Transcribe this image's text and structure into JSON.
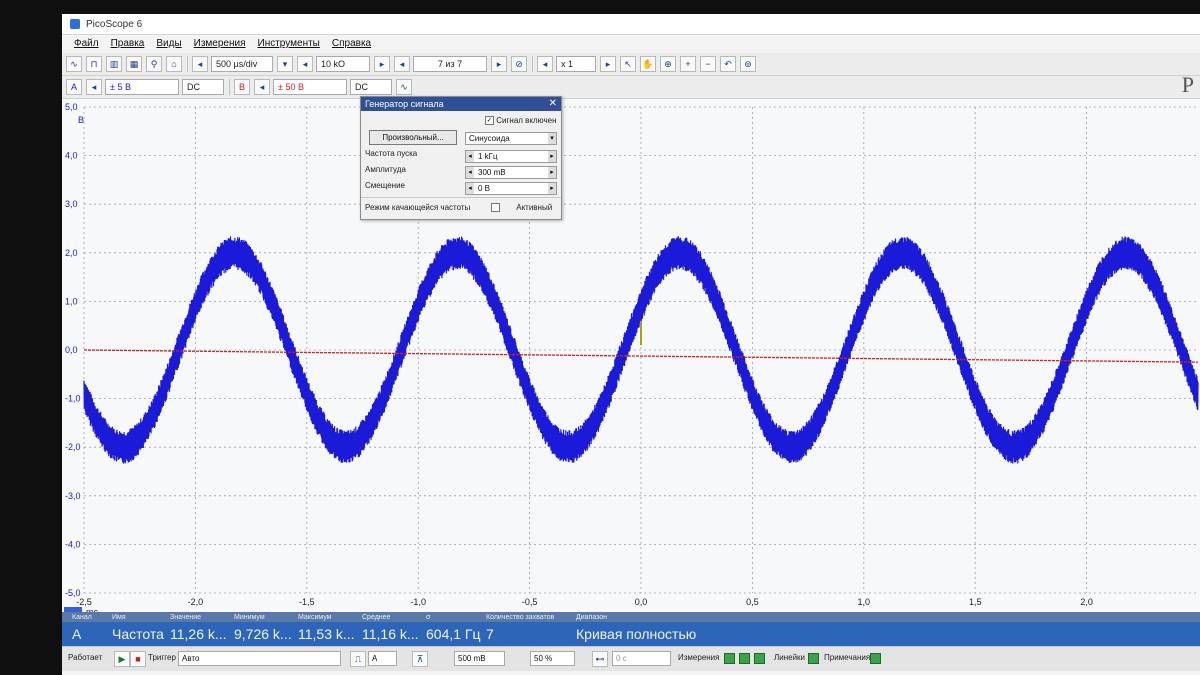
{
  "window": {
    "title": "PicoScope 6"
  },
  "menu": [
    "Файл",
    "Правка",
    "Виды",
    "Измерения",
    "Инструменты",
    "Справка"
  ],
  "toolbar1": {
    "timebase": "500 µs/div",
    "samples": "10 kO",
    "capture": "7 из 7",
    "zoom": "x 1"
  },
  "toolbar2": {
    "channel_a_label": "A",
    "channel_a_range": "± 5 В",
    "channel_a_coupling": "DC",
    "channel_b_label": "B",
    "channel_b_range": "± 50 В",
    "channel_b_coupling": "DC"
  },
  "brand": "P",
  "siggen": {
    "title": "Генератор сигнала",
    "enabled_label": "Сигнал включен",
    "arbitrary_button": "Произвольный...",
    "waveform": "Синусоида",
    "start_freq_label": "Частота пуска",
    "start_freq_value": "1 kГц",
    "amplitude_label": "Амплитуда",
    "amplitude_value": "300 mВ",
    "offset_label": "Смещение",
    "offset_value": "0 В",
    "sweep_label": "Режим качающейся частоты",
    "sweep_active_label": "Активный"
  },
  "chart_data": {
    "type": "line",
    "x_unit": "mc",
    "y_top_label": "В",
    "xlim": [
      -2.5,
      2.5
    ],
    "ylim": [
      -5.0,
      5.0
    ],
    "x_ticks": [
      "-2,5",
      "-2,0",
      "-1,5",
      "-1,0",
      "-0,5",
      "0,0",
      "0,5",
      "1,0",
      "1,5",
      "2,0"
    ],
    "y_ticks": [
      "5,0",
      "4,0",
      "3,0",
      "2,0",
      "1,0",
      "0,0",
      "-1,0",
      "-2,0",
      "-3,0",
      "-4,0",
      "-5,0"
    ],
    "grid": true,
    "series": [
      {
        "channel": "A",
        "color": "#1a1ad8",
        "wave": "sine",
        "frequency_khz": 1.0,
        "amplitude_v": 2.0,
        "noise_band_v": 0.35
      },
      {
        "channel": "B",
        "color": "#d42020",
        "wave": "flat",
        "level_start_v": 0.0,
        "level_end_v": -0.25
      }
    ]
  },
  "measurements": {
    "headers": [
      "Канал",
      "Имя",
      "Значение",
      "Минимум",
      "Максимум",
      "Среднее",
      "σ",
      "Количество захватов",
      "Диапазон"
    ],
    "row": {
      "channel": "A",
      "name": "Частота",
      "value": "11,26 k...",
      "min": "9,726 k...",
      "max": "11,53 k...",
      "avg": "11,16 k...",
      "sigma": "604,1 Гц",
      "captures": "7",
      "range": "Кривая полностью"
    }
  },
  "status": {
    "run_label": "Работает",
    "trigger_label": "Триггер",
    "trigger_mode": "Авто",
    "trigger_channel": "A",
    "trigger_level": "500 mВ",
    "pretrigger": "50 %",
    "delay": "0 с",
    "measurements_label": "Измерения",
    "rulers_label": "Линейки",
    "notes_label": "Примечания"
  },
  "colors": {
    "accent": "#2d66b8",
    "channel_a": "#1a1ad8",
    "channel_b": "#d42020"
  }
}
